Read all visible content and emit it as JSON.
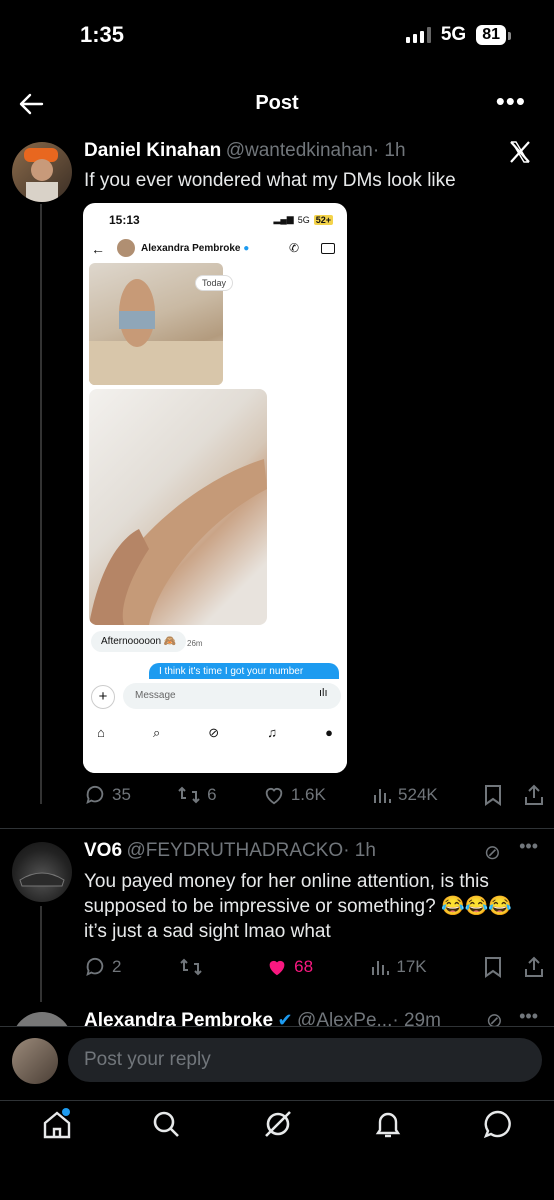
{
  "status": {
    "time": "1:35",
    "network": "5G",
    "battery": "81"
  },
  "header": {
    "title": "Post"
  },
  "post": {
    "author_name": "Daniel Kinahan",
    "author_handle": "@wantedkinahan",
    "time": "· 1h",
    "text": "If you ever wondered what my DMs look like",
    "embed": {
      "time": "15:13",
      "network": "5G",
      "battery": "52+",
      "contact_name": "Alexandra Pembroke",
      "date_label": "Today",
      "incoming_message": "Afternooooon 🙈",
      "incoming_time": "26m",
      "outgoing_message": "I think it's time I got your number",
      "input_placeholder": "Message"
    },
    "stats": {
      "replies": "35",
      "reposts": "6",
      "likes": "1.6K",
      "views": "524K"
    }
  },
  "reply1": {
    "author_name": "VO6",
    "author_handle": "@FEYDRUTHADRACKO",
    "time": "· 1h",
    "text": "You payed money for her online attention, is this supposed to be impressive or something? 😂😂😂 it’s just a sad sight lmao what",
    "stats": {
      "replies": "2",
      "reposts": "",
      "likes": "68",
      "views": "17K"
    }
  },
  "reply2": {
    "author_name": "Alexandra Pembroke",
    "author_handle": "@AlexPe...",
    "time": "· 29m"
  },
  "composer": {
    "placeholder": "Post your reply"
  },
  "colors": {
    "accent": "#1d9bf0",
    "like": "#f91880",
    "background": "#000000"
  }
}
